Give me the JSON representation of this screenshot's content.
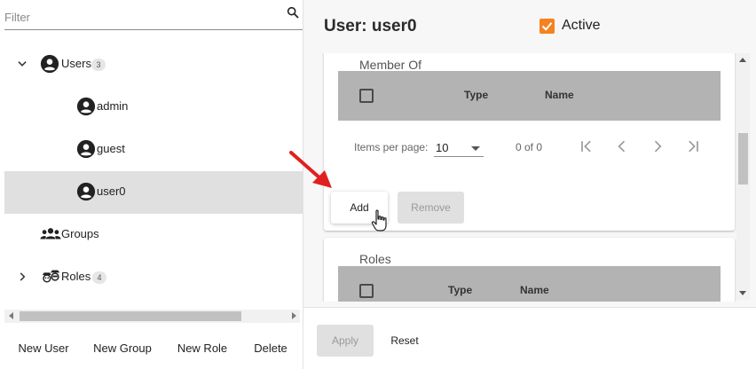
{
  "filter": {
    "placeholder": "Filter"
  },
  "tree": {
    "users": {
      "label": "Users",
      "count": "3"
    },
    "admin": {
      "label": "admin"
    },
    "guest": {
      "label": "guest"
    },
    "user0": {
      "label": "user0"
    },
    "groups": {
      "label": "Groups"
    },
    "roles": {
      "label": "Roles",
      "count": "4"
    }
  },
  "left_actions": {
    "new_user": "New User",
    "new_group": "New Group",
    "new_role": "New Role",
    "delete": "Delete"
  },
  "detail": {
    "title": "User: user0",
    "active_label": "Active",
    "active_checked": true
  },
  "member_of": {
    "title": "Member Of",
    "columns": [
      "Type",
      "Name"
    ],
    "items_per_page_label": "Items per page:",
    "items_per_page_value": "10",
    "range_label": "0 of 0",
    "add_label": "Add",
    "remove_label": "Remove"
  },
  "roles_card": {
    "title": "Roles",
    "columns": [
      "Type",
      "Name"
    ]
  },
  "footer": {
    "apply_label": "Apply",
    "reset_label": "Reset"
  },
  "colors": {
    "accent": "#f5821f",
    "selected_row": "#e0e0e0",
    "table_header": "#b3b3b3",
    "annotation_arrow": "#e02020"
  }
}
